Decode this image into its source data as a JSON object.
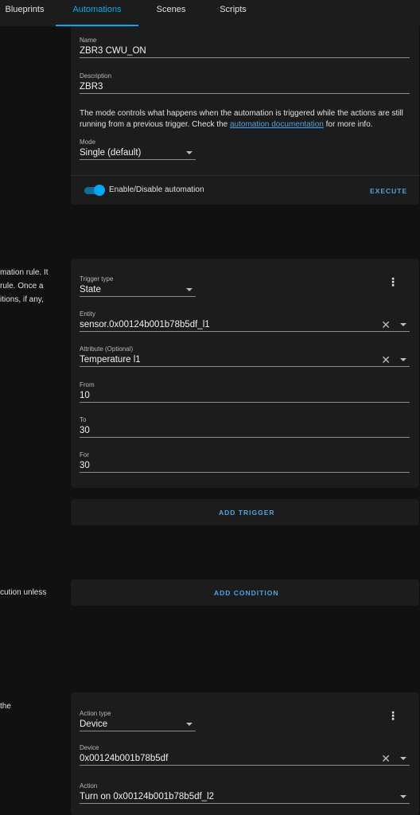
{
  "tabs": {
    "blueprints": "Blueprints",
    "automations": "Automations",
    "scenes": "Scenes",
    "scripts": "Scripts"
  },
  "sidebar": {
    "trigger_lines": [
      "mation rule. It",
      "rule. Once a",
      "itions, if any,"
    ],
    "condition_line": "cution unless",
    "action_line": "the"
  },
  "details": {
    "name_label": "Name",
    "name_value": "ZBR3 CWU_ON",
    "description_label": "Description",
    "description_value": "ZBR3",
    "mode_text_before": "The mode controls what happens when the automation is triggered while the actions are still running from a previous trigger. Check the ",
    "mode_link": "automation documentation",
    "mode_text_after": " for more info.",
    "mode_label": "Mode",
    "mode_value": "Single (default)",
    "toggle_label": "Enable/Disable automation",
    "execute_label": "EXECUTE"
  },
  "trigger": {
    "type_label": "Trigger type",
    "type_value": "State",
    "entity_label": "Entity",
    "entity_value": "sensor.0x00124b001b78b5df_l1",
    "attribute_label": "Attribute (Optional)",
    "attribute_value": "Temperature l1",
    "from_label": "From",
    "from_value": "10",
    "to_label": "To",
    "to_value": "30",
    "for_label": "For",
    "for_value": "30",
    "add_trigger_label": "ADD TRIGGER"
  },
  "condition": {
    "add_condition_label": "ADD CONDITION"
  },
  "action": {
    "type_label": "Action type",
    "type_value": "Device",
    "device_label": "Device",
    "device_value": "0x00124b001b78b5df",
    "action_label": "Action",
    "action_value": "Turn on 0x00124b001b78b5df_l2"
  },
  "colors": {
    "accent": "#03a9f4",
    "link": "#4fa3e0",
    "card": "#1c1c1c",
    "background": "#111111"
  }
}
